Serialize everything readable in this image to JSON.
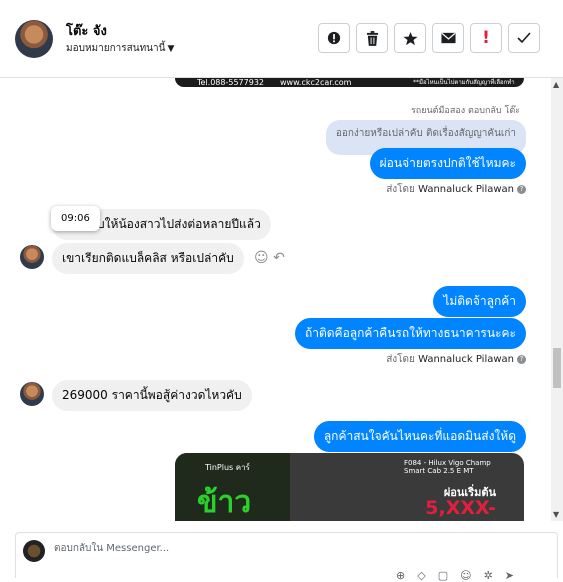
{
  "header": {
    "name": "โต๊ะ จัง",
    "assign_label": "มอบหมายการสนทนานี้",
    "buttons": [
      "alert-button",
      "delete-button",
      "star-button",
      "mail-button",
      "flag-button",
      "done-button"
    ]
  },
  "thread": {
    "top_image_text": [
      "Tel.088-5577932",
      "www.ckc2car.com",
      "**มือไหนเป็นไปตามกับสัญญาที่เลือกทำหมด**"
    ],
    "reply_meta": "↱ตอบกลับ โต๊ะ",
    "reply_meta_prefix": "รถยนต์มือสอง ตอบกลับ โต๊ะ",
    "reply_quote": "ออกง่ายหรือเปล่าคับ ติดเรื่องสัญญาคันเก่า",
    "msg1": "ผ่อนจ่ายตรงปกติใช้ไหมคะ",
    "sent_by_label": "ส่งโดย",
    "sent_by_name": "Wannaluck Pilawan",
    "tooltip_time": "09:06",
    "in1": "ต้องคับให้น้องสาวไปส่งต่อหลายปีแล้ว",
    "in1_visible": "จคับให้น้องสาวไปส่งต่อหลายปีแล้ว",
    "in2": "เขาเรียกติดแบล็คลิส หรือเปล่าคับ",
    "out2": "ไม่ติดจ้าลูกค้า",
    "out3": "ถ้าติดคือลูกค้าคืนรถให้ทางธนาคารนะคะ",
    "in3": "269000 ราคานี้พอสู้ค่างวดไหวคับ",
    "out4": "ลูกค้าสนใจคันไหนคะที่แอดมินส่งให้ดู",
    "promo": {
      "brand": "TinPlus คาร์",
      "big_text": "ข้าว",
      "model": "F084 - Hilux Vigo Champ Smart Cab 2.5 E MT",
      "price_label": "ผ่อนเริ่มต้น",
      "price": "5,XXX-"
    }
  },
  "composer": {
    "placeholder": "ตอบกลับใน Messenger..."
  },
  "colors": {
    "accent": "#0084ff",
    "incoming_bg": "#f0f0f0",
    "quote_bg": "#dbe4f5",
    "alert_red": "#e41e3f"
  }
}
